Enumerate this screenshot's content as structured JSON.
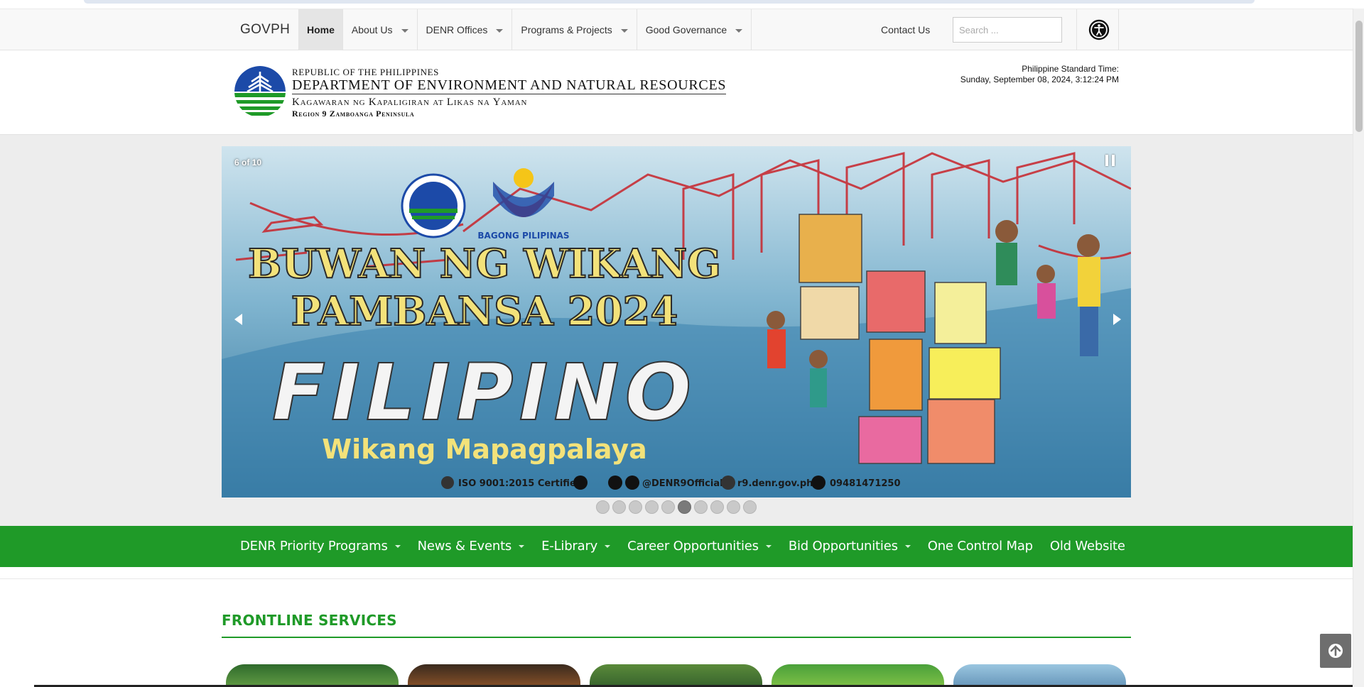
{
  "govph_nav": {
    "brand": "GOVPH",
    "items": [
      {
        "label": "Home",
        "active": true,
        "dropdown": false
      },
      {
        "label": "About Us",
        "active": false,
        "dropdown": true
      },
      {
        "label": "DENR Offices",
        "active": false,
        "dropdown": true
      },
      {
        "label": "Programs & Projects",
        "active": false,
        "dropdown": true
      },
      {
        "label": "Good Governance",
        "active": false,
        "dropdown": true
      }
    ],
    "contact": "Contact Us",
    "search_placeholder": "Search ...",
    "accessibility_icon": "accessibility-icon"
  },
  "header": {
    "line1": "Republic of the Philippines",
    "line2": "Department of Environment and Natural Resources",
    "line3": "Kagawaran ng Kapaligiran at Likas na Yaman",
    "line4": "Region 9 Zamboanga Peninsula",
    "pst_label": "Philippine Standard Time:",
    "pst_value": "Sunday, September 08, 2024, 3:12:24 PM"
  },
  "carousel": {
    "counter": "6 of 10",
    "current": 6,
    "total": 10,
    "banner": {
      "partner_logo_text": "BAGONG PILIPINAS",
      "headline1": "BUWAN NG WIKANG",
      "headline2": "PAMBANSA 2024",
      "headline3": "FILIPINO",
      "tagline": "Wikang Mapagpalaya",
      "footer": [
        "ISO 9001:2015 Certified",
        "@DENR9Official",
        "r9.denr.gov.ph",
        "09481471250"
      ]
    }
  },
  "green_nav": {
    "items": [
      {
        "label": "DENR Priority Programs",
        "dropdown": true
      },
      {
        "label": "News & Events",
        "dropdown": true
      },
      {
        "label": "E-Library",
        "dropdown": true
      },
      {
        "label": "Career Opportunities",
        "dropdown": true
      },
      {
        "label": "Bid Opportunities",
        "dropdown": true
      },
      {
        "label": "One Control Map",
        "dropdown": false
      },
      {
        "label": "Old Website",
        "dropdown": false
      }
    ]
  },
  "frontline": {
    "title": "FRONTLINE SERVICES"
  },
  "colors": {
    "brand_green": "#1f9a28",
    "nav_bg": "#f8f8f8",
    "carousel_bg": "#ededed"
  }
}
